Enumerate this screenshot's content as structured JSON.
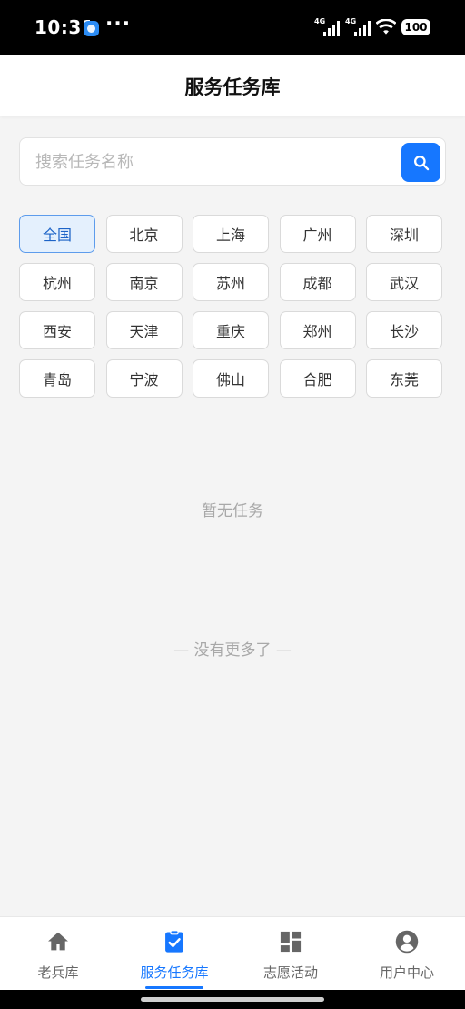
{
  "status_bar": {
    "time": "10:31",
    "dots": "···",
    "network1": "4G",
    "network2": "4G",
    "battery": "100"
  },
  "header": {
    "title": "服务任务库"
  },
  "search": {
    "placeholder": "搜索任务名称",
    "value": ""
  },
  "cities": [
    "全国",
    "北京",
    "上海",
    "广州",
    "深圳",
    "杭州",
    "南京",
    "苏州",
    "成都",
    "武汉",
    "西安",
    "天津",
    "重庆",
    "郑州",
    "长沙",
    "青岛",
    "宁波",
    "佛山",
    "合肥",
    "东莞"
  ],
  "selected_city": "全国",
  "empty_text": "暂无任务",
  "no_more_text": "— 没有更多了 —",
  "tabs": [
    {
      "label": "老兵库",
      "icon": "home-icon"
    },
    {
      "label": "服务任务库",
      "icon": "task-check-icon"
    },
    {
      "label": "志愿活动",
      "icon": "dashboard-icon"
    },
    {
      "label": "用户中心",
      "icon": "user-icon"
    }
  ],
  "active_tab": 1,
  "colors": {
    "accent": "#1677ff",
    "active_city_bg": "#e4f0fd",
    "active_city_border": "#5d9cec"
  }
}
